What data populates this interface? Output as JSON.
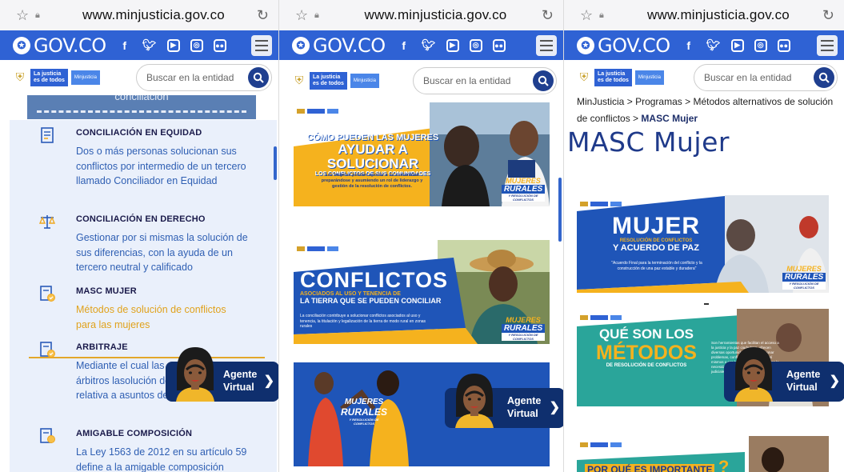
{
  "browser": {
    "url": "www.minjusticia.gov.co"
  },
  "govbar": {
    "brand": "GOV.CO",
    "social_icons": [
      "facebook-icon",
      "twitter-icon",
      "youtube-icon",
      "instagram-icon",
      "flickr-icon"
    ]
  },
  "header": {
    "logo_line1": "La justicia",
    "logo_line2": "es de todos",
    "logo_entity": "Minjusticia",
    "search_placeholder": "Buscar en la entidad"
  },
  "panel1": {
    "banner_text": "conciliación",
    "items": [
      {
        "title": "CONCILIACIÓN EN EQUIDAD",
        "desc": "Dos o más personas solucionan sus conflictos por intermedio de un tercero llamado Conciliador en Equidad",
        "icon": "document-icon"
      },
      {
        "title": "CONCILIACIÓN EN DERECHO",
        "desc": "Gestionar por si mismas la solución de sus diferencias, con la ayuda de un tercero neutral y calificado",
        "icon": "scales-icon"
      },
      {
        "title": "MASC MUJER",
        "desc": "Métodos de solución de conflictos para las mujeres",
        "icon": "file-check-icon"
      },
      {
        "title": "ARBITRAJE",
        "desc": "Mediante el cual las partes defieren a árbitros lasolución de una controversia relativa a asuntos de libre disposición",
        "icon": "file-check-icon"
      },
      {
        "title": "AMIGABLE COMPOSICIÓN",
        "desc": "La Ley 1563 de 2012 en su artículo 59 define a la amigable composición",
        "icon": "file-badge-icon"
      }
    ]
  },
  "agent": {
    "line1": "Agente",
    "line2": "Virtual"
  },
  "panel2": {
    "cards": [
      {
        "headline1": "CÓMO PUEDEN LAS MUJERES",
        "headline2": "AYUDAR A SOLUCIONAR",
        "headline3": "LOS CONFLICTOS DE SUS COMUNIDADES",
        "body": "Las mujeres pueden aportar a su comunidad preparándose y asumiendo un rol de liderazgo y gestión de la resolución de conflictos.",
        "badge1": "MUJERES",
        "badge2": "RURALES",
        "badge3": "Y RESOLUCIÓN DE CONFLICTOS"
      },
      {
        "headline1": "CONFLICTOS",
        "headline2": "ASOCIADOS AL USO Y TENENCIA DE",
        "headline3": "LA TIERRA QUE SE PUEDEN CONCILIAR",
        "body": "La conciliación contribuye a solucionar conflictos asociados al uso y tenencia, la titulación y legalización de la tierra de modo rural en zonas rurales",
        "badge1": "MUJERES",
        "badge2": "RURALES",
        "badge3": "Y RESOLUCIÓN DE CONFLICTOS"
      },
      {
        "badge1": "MUJERES",
        "badge2": "RURALES",
        "badge3": "Y RESOLUCIÓN DE CONFLICTOS"
      }
    ]
  },
  "panel3": {
    "breadcrumb": [
      "MinJusticia",
      "Programas",
      "Métodos alternativos de solución de conflictos",
      "MASC Mujer"
    ],
    "breadcrumb_sep": ">",
    "title": "MASC Mujer",
    "cards": [
      {
        "headline1": "MUJER",
        "headline2": "RESOLUCIÓN DE CONFLICTOS",
        "headline3": "Y ACUERDO DE PAZ",
        "body": "\"Acuerdo Final para la terminación del conflicto y la construcción de una paz estable y duradera\"",
        "badge1": "MUJERES",
        "badge2": "RURALES",
        "badge3": "Y RESOLUCIÓN DE CONFLICTOS"
      },
      {
        "headline1": "QUÉ SON LOS",
        "headline2": "MÉTODOS",
        "headline3": "DE RESOLUCIÓN DE CONFLICTOS",
        "body": "Son herramientas que facilitan el acceso a la justicia y la paz ciudadana, ofrecen diversas oportunidades para solucionar problemas, conflictos y disputas por sí mismos o con la ayuda de un tercero en la necesidad de acceder a los despachos judiciales."
      },
      {
        "headline1": "POR QUÉ ES IMPORTANTE",
        "headline2": "?"
      }
    ]
  },
  "colors": {
    "govbar": "#2f62d4",
    "title_blue": "#1f3a8a",
    "accent_yellow": "#f5b21e",
    "card_blue": "#1f55b8",
    "agent_bg": "#0f2f6e"
  }
}
